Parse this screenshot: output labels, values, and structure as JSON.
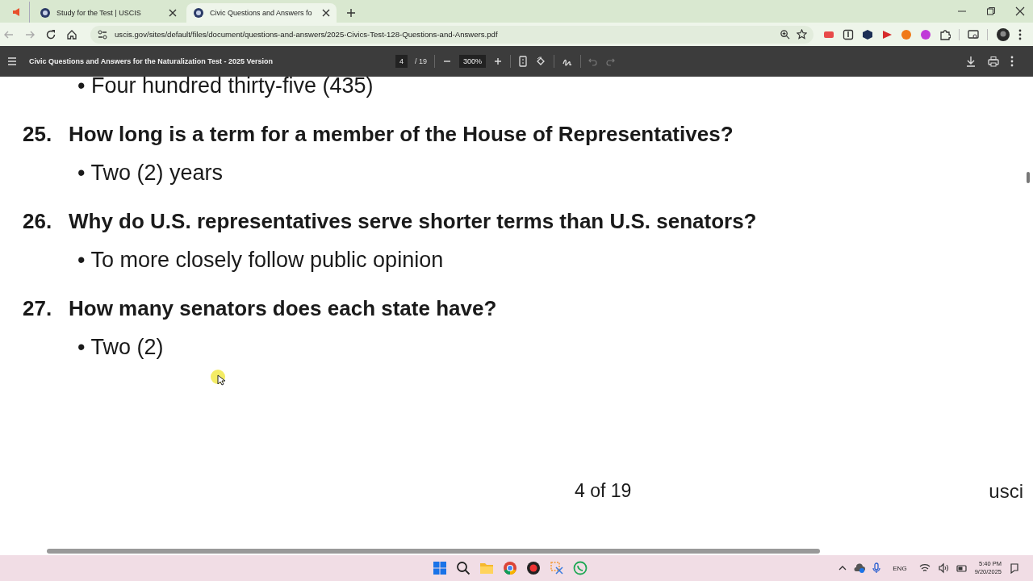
{
  "tabs": [
    {
      "title": "Study for the Test | USCIS",
      "selected": false
    },
    {
      "title": "Civic Questions and Answers fo",
      "selected": true
    }
  ],
  "address": "uscis.gov/sites/default/files/document/questions-and-answers/2025-Civics-Test-128-Questions-and-Answers.pdf",
  "pdf_toolbar": {
    "title": "Civic Questions and Answers for the Naturalization Test - 2025 Version",
    "page": "4",
    "page_total": "/ 19",
    "zoom": "300%"
  },
  "document": {
    "leading_answers": [
      "• Four hundred thirty-five (435)"
    ],
    "questions": [
      {
        "number": "25.",
        "text": "How long is a term for a member of the House of Representatives?",
        "answers": [
          "• Two (2) years"
        ]
      },
      {
        "number": "26.",
        "text": "Why do U.S. representatives serve shorter terms than U.S. senators?",
        "answers": [
          "• To more closely follow public opinion"
        ]
      },
      {
        "number": "27.",
        "text": "How many senators does each state have?",
        "answers": [
          "• Two (2)"
        ]
      }
    ],
    "page_footer": "4 of 19",
    "footer_logo_text": "usci"
  },
  "taskbar": {
    "language": "ENG",
    "time": "5:40 PM",
    "date": "9/20/2025"
  }
}
